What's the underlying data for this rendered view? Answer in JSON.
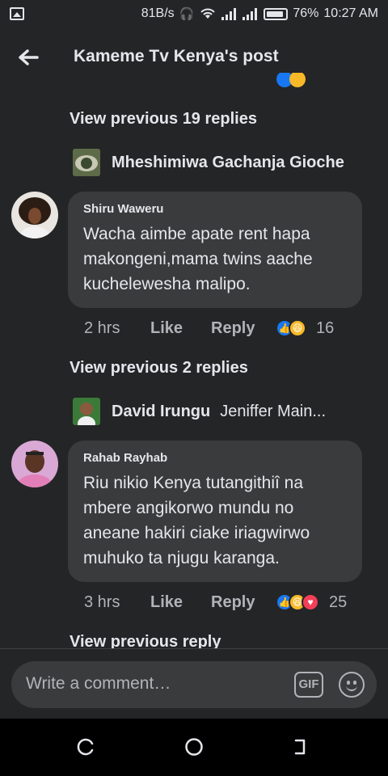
{
  "status_bar": {
    "speed": "81B/s",
    "battery": "76%",
    "time": "10:27 AM"
  },
  "header": {
    "title": "Kameme Tv Kenya's post"
  },
  "thread": {
    "view_prev_19": "View previous 19 replies",
    "preview_1": {
      "name": "Mheshimiwa Gachanja Gioche",
      "text": ""
    },
    "comment_1": {
      "author": "Shiru Waweru",
      "text": "Wacha aimbe apate rent hapa makongeni,mama twins aache kuchelewesha malipo.",
      "time": "2 hrs",
      "like": "Like",
      "reply": "Reply",
      "count": "16"
    },
    "view_prev_2": "View previous 2 replies",
    "preview_2": {
      "name": "David Irungu",
      "text": "Jeniffer Main..."
    },
    "comment_2": {
      "author": "Rahab Rayhab",
      "text": "Riu nikio Kenya tutangithiî na mbere angikorwo mundu no aneane hakiri ciake iriagwirwo muhuko ta njugu karanga.",
      "time": "3 hrs",
      "like": "Like",
      "reply": "Reply",
      "count": "25"
    },
    "view_prev_reply": "View previous reply"
  },
  "composer": {
    "placeholder": "Write a comment…",
    "gif": "GIF"
  },
  "icons": {
    "back": "arrow-left-icon",
    "gif": "gif-icon",
    "emoji": "smiley-icon"
  },
  "colors": {
    "background": "#242526",
    "bubble": "#3a3b3c",
    "like": "#1877f2",
    "haha": "#f7b928",
    "love": "#f33e58"
  }
}
